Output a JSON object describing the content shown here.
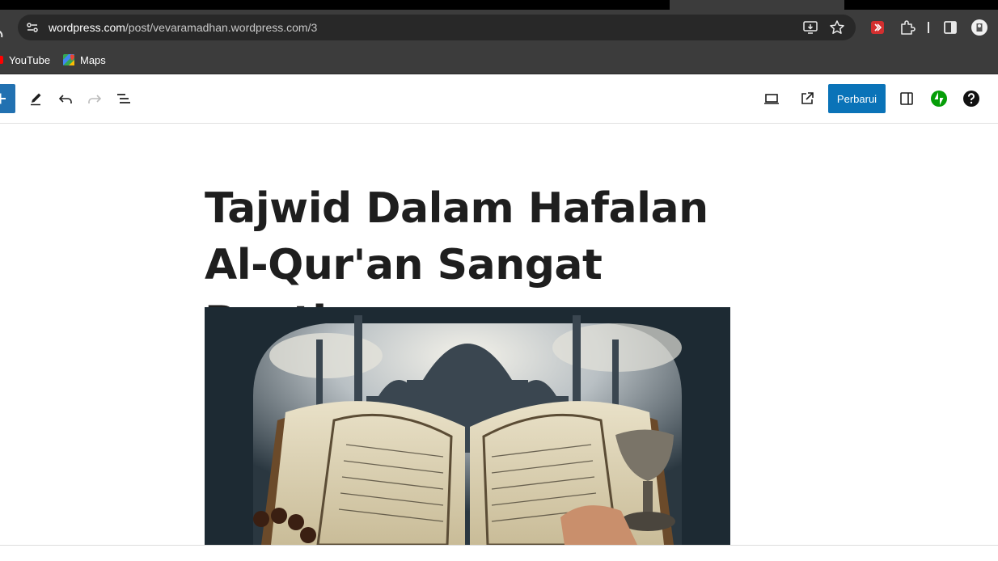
{
  "browser": {
    "url_host": "wordpress.com",
    "url_path": "/post/vevaramadhan.wordpress.com/3",
    "bookmarks": [
      {
        "label": "YouTube",
        "icon": "youtube-icon"
      },
      {
        "label": "Maps",
        "icon": "maps-icon"
      }
    ]
  },
  "editor": {
    "update_label": "Perbarui",
    "post_title": "Tajwid Dalam Hafalan Al-Qur'an Sangat Penting."
  },
  "colors": {
    "update_button": "#0a73b8",
    "add_button": "#2271b1",
    "jetpack": "#069e08"
  }
}
